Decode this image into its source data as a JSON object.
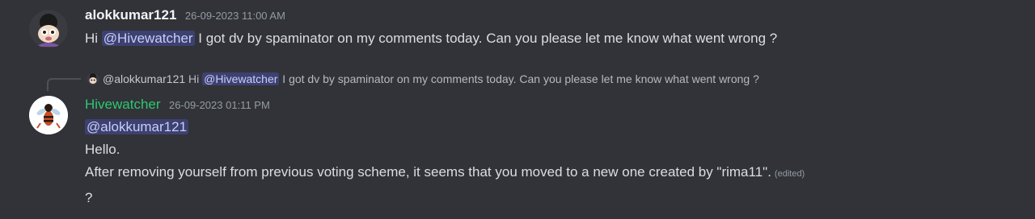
{
  "messages": [
    {
      "author": "alokkumar121",
      "timestamp": "26-09-2023 11:00 AM",
      "parts": {
        "pre": "Hi ",
        "mention": "@Hivewatcher",
        "post": " I got dv by spaminator on my comments today. Can you please let me know what went wrong ?"
      }
    },
    {
      "reply": {
        "user": "@alokkumar121",
        "pre": " Hi ",
        "mention": "@Hivewatcher",
        "post": " I got dv by spaminator on my comments today. Can you please let me know what went wrong ?"
      },
      "author": "Hivewatcher",
      "timestamp": "26-09-2023 01:11 PM",
      "mention_line": "@alokkumar121",
      "line2": "Hello.",
      "line3": "After removing yourself from previous voting scheme, it seems that you moved to a new one created by \"rima11\".",
      "edited": "(edited)",
      "line4": "?"
    }
  ],
  "colors": {
    "background": "#313338",
    "hivewatcher_name": "#2dc770",
    "mention_bg": "#3c4270"
  }
}
